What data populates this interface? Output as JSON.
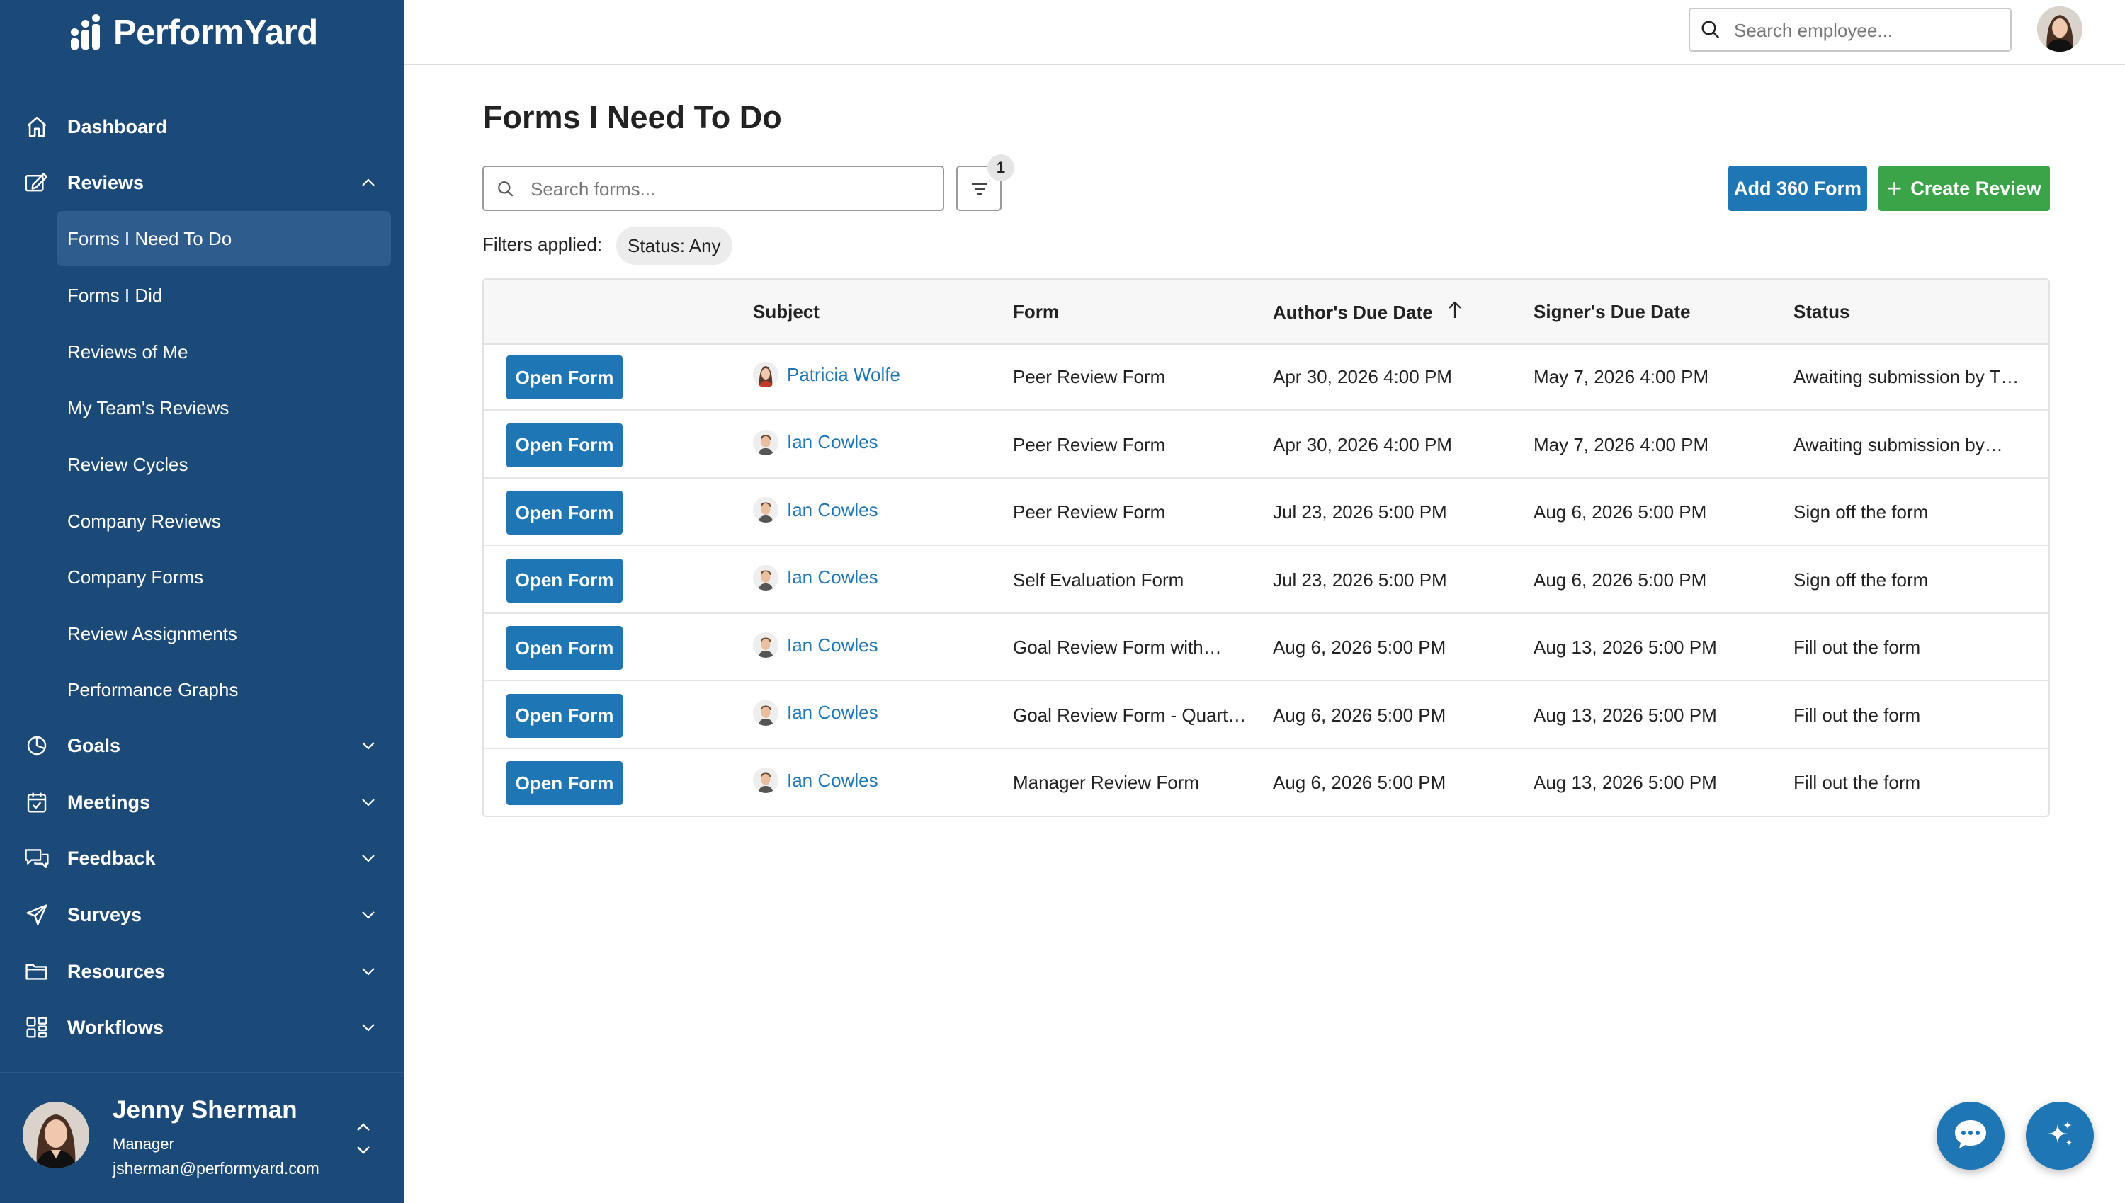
{
  "app": {
    "brand": "PerformYard"
  },
  "sidebar": {
    "nav": [
      {
        "label": "Dashboard",
        "icon": "home-icon"
      },
      {
        "label": "Reviews",
        "icon": "reviews-icon",
        "expanded": true
      },
      {
        "label": "Goals",
        "icon": "goals-icon"
      },
      {
        "label": "Meetings",
        "icon": "calendar-icon"
      },
      {
        "label": "Feedback",
        "icon": "feedback-icon"
      },
      {
        "label": "Surveys",
        "icon": "send-icon"
      },
      {
        "label": "Resources",
        "icon": "folder-icon"
      },
      {
        "label": "Workflows",
        "icon": "workflows-icon"
      }
    ],
    "reviews_submenu": [
      "Forms I Need To Do",
      "Forms I Did",
      "Reviews of Me",
      "My Team's Reviews",
      "Review Cycles",
      "Company Reviews",
      "Company Forms",
      "Review Assignments",
      "Performance Graphs"
    ],
    "active_item": "Forms I Need To Do",
    "user": {
      "name": "Jenny Sherman",
      "role": "Manager",
      "email": "jsherman@performyard.com"
    }
  },
  "topbar": {
    "search_placeholder": "Search employee..."
  },
  "main": {
    "title": "Forms I Need To Do",
    "search_placeholder": "Search forms...",
    "filter_count": "1",
    "add_360_label": "Add 360 Form",
    "create_review_label": "Create Review",
    "filters_applied_label": "Filters applied:",
    "filter_chip": "Status: Any"
  },
  "table": {
    "columns": [
      "",
      "Subject",
      "Form",
      "Author's Due Date",
      "Signer's Due Date",
      "Status"
    ],
    "sorted_column": "Author's Due Date",
    "sort_direction": "ascending",
    "action_label": "Open Form",
    "rows": [
      {
        "subject": "Patricia Wolfe",
        "form": "Peer Review Form",
        "author_due": "Apr 30, 2026 4:00 PM",
        "signer_due": "May 7, 2026 4:00 PM",
        "status": "Awaiting submission by T…"
      },
      {
        "subject": "Ian Cowles",
        "form": "Peer Review Form",
        "author_due": "Apr 30, 2026 4:00 PM",
        "signer_due": "May 7, 2026 4:00 PM",
        "status": "Awaiting submission by…"
      },
      {
        "subject": "Ian Cowles",
        "form": "Peer Review Form",
        "author_due": "Jul 23, 2026 5:00 PM",
        "signer_due": "Aug 6, 2026 5:00 PM",
        "status": "Sign off the form"
      },
      {
        "subject": "Ian Cowles",
        "form": "Self Evaluation Form",
        "author_due": "Jul 23, 2026 5:00 PM",
        "signer_due": "Aug 6, 2026 5:00 PM",
        "status": "Sign off the form"
      },
      {
        "subject": "Ian Cowles",
        "form": "Goal Review Form with…",
        "author_due": "Aug 6, 2026 5:00 PM",
        "signer_due": "Aug 13, 2026 5:00 PM",
        "status": "Fill out the form"
      },
      {
        "subject": "Ian Cowles",
        "form": "Goal Review Form - Quarterly",
        "author_due": "Aug 6, 2026 5:00 PM",
        "signer_due": "Aug 13, 2026 5:00 PM",
        "status": "Fill out the form"
      },
      {
        "subject": "Ian Cowles",
        "form": "Manager Review Form",
        "author_due": "Aug 6, 2026 5:00 PM",
        "signer_due": "Aug 13, 2026 5:00 PM",
        "status": "Fill out the form"
      }
    ]
  },
  "fabs": [
    {
      "icon": "chat-icon"
    },
    {
      "icon": "ai-sparkle-icon"
    }
  ],
  "colors": {
    "sidebar_bg": "#1c4a78",
    "sidebar_active": "#2e5c8c",
    "primary_blue": "#1f76b5",
    "create_green": "#3ba448",
    "link_blue": "#1f76b5"
  }
}
